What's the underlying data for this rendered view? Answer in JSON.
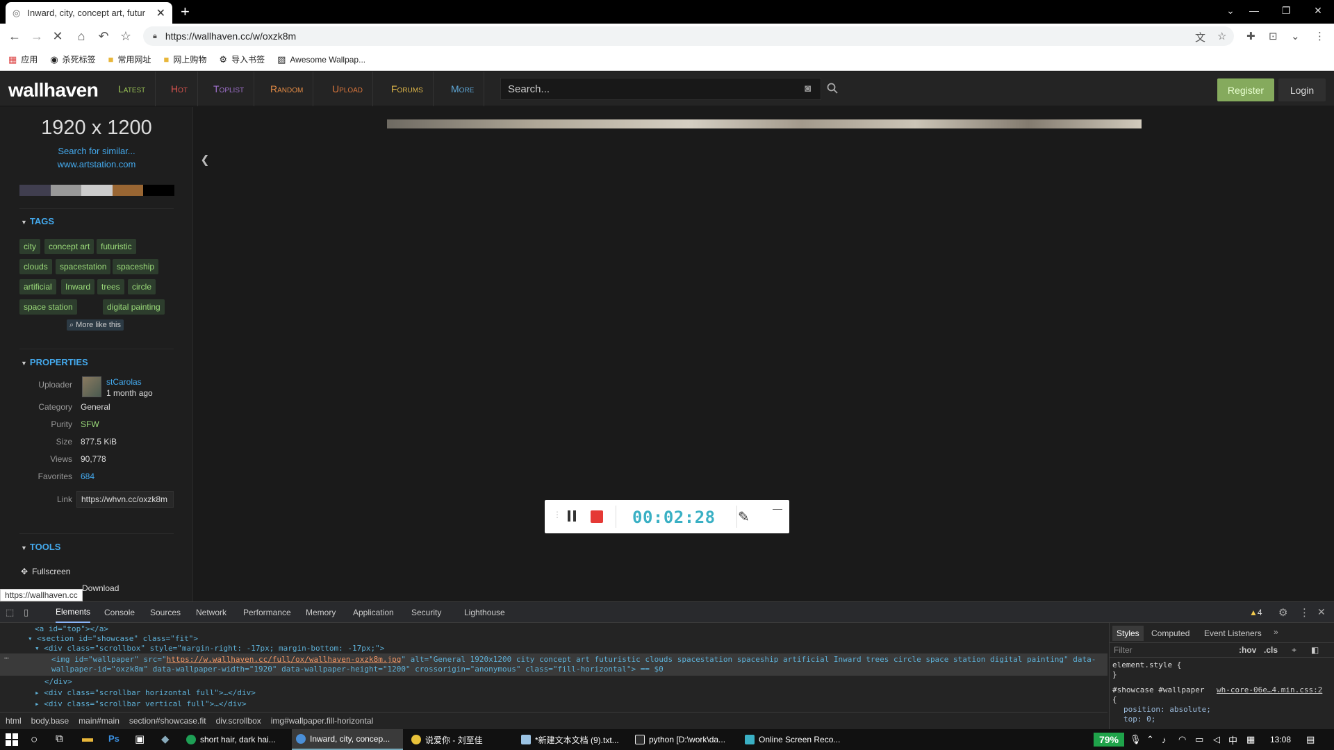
{
  "browser": {
    "tab_title": "Inward, city, concept art, futur",
    "url": "https://wallhaven.cc/w/oxzk8m",
    "bookmarks": [
      "应用",
      "杀死标签",
      "常用网址",
      "网上购物",
      "导入书签",
      "Awesome Wallpap..."
    ]
  },
  "header": {
    "logo": "wallhaven",
    "nav": [
      {
        "label": "Latest",
        "color": "#99c255"
      },
      {
        "label": "Hot",
        "color": "#d9534f"
      },
      {
        "label": "Toplist",
        "color": "#9f71cc"
      },
      {
        "label": "Random",
        "color": "#e38b45"
      },
      {
        "label": "Upload",
        "color": "#d9763c"
      },
      {
        "label": "Forums",
        "color": "#e0b84a"
      },
      {
        "label": "More",
        "color": "#5ea8d8"
      }
    ],
    "search_placeholder": "Search...",
    "register": "Register",
    "login": "Login"
  },
  "sidebar": {
    "resolution": "1920 x 1200",
    "search_similar": "Search for similar...",
    "source": "www.artstation.com",
    "palette": [
      "#403e4f",
      "#999999",
      "#cccccc",
      "#996633",
      "#000000"
    ],
    "tags_heading": "TAGS",
    "tags": [
      "city",
      "concept art",
      "futuristic",
      "clouds",
      "spacestation",
      "spaceship",
      "artificial",
      "Inward",
      "trees",
      "circle",
      "space station",
      "digital painting"
    ],
    "more_like": "More like this",
    "properties_heading": "PROPERTIES",
    "properties": {
      "uploader_label": "Uploader",
      "uploader_name": "stCarolas",
      "uploader_time": "1 month ago",
      "category_label": "Category",
      "category": "General",
      "purity_label": "Purity",
      "purity": "SFW",
      "size_label": "Size",
      "size": "877.5 KiB",
      "views_label": "Views",
      "views": "90,778",
      "favorites_label": "Favorites",
      "favorites": "684",
      "link_label": "Link",
      "link": "https://whvn.cc/oxzk8m"
    },
    "tools_heading": "TOOLS",
    "tools": [
      "Fullscreen",
      "Download"
    ],
    "status_url": "https://wallhaven.cc"
  },
  "recorder": {
    "time": "00:02:28"
  },
  "devtools": {
    "tabs": [
      "Elements",
      "Console",
      "Sources",
      "Network",
      "Performance",
      "Memory",
      "Application",
      "Security",
      "Lighthouse"
    ],
    "warnings": "4",
    "code": {
      "l1": "<a id=\"top\"></a>",
      "l2": "<section id=\"showcase\" class=\"fit\">",
      "l3": "<div class=\"scrollbox\" style=\"margin-right: -17px; margin-bottom: -17px;\">",
      "l4a": "<img id=\"wallpaper\" src=\"",
      "l4link": "https://w.wallhaven.cc/full/ox/wallhaven-oxzk8m.jpg",
      "l4b": "\" alt=\"General 1920x1200 city concept art futuristic clouds spacestation spaceship artificial Inward trees circle space station digital painting\" data-",
      "l5": "wallpaper-id=\"oxzk8m\" data-wallpaper-width=\"1920\" data-wallpaper-height=\"1200\" crossorigin=\"anonymous\" class=\"fill-horizontal\"> == $0",
      "l6": "</div>",
      "l7": "<div class=\"scrollbar horizontal full\">…</div>",
      "l8": "<div class=\"scrollbar vertical full\">…</div>"
    },
    "breadcrumb": [
      "html",
      "body.base",
      "main#main",
      "section#showcase.fit",
      "div.scrollbox",
      "img#wallpaper.fill-horizontal"
    ],
    "styles_tabs": [
      "Styles",
      "Computed",
      "Event Listeners"
    ],
    "filter": "Filter",
    "hov": ":hov",
    "cls": ".cls",
    "styles": {
      "s1": "element.style {",
      "s2": "}",
      "s3": "#showcase #wallpaper",
      "s3src": "wh-core-06e…4.min.css:2",
      "s4": "{",
      "s5": "position: absolute;",
      "s6": "top: 0;"
    }
  },
  "taskbar": {
    "apps": [
      "short hair, dark hai...",
      "Inward, city, concep...",
      "说爱你 - 刘至佳",
      "*新建文本文档 (9).txt...",
      "python [D:\\work\\da...",
      "Online Screen Reco..."
    ],
    "battery": "79%",
    "ime": "中",
    "clock": "13:08"
  }
}
